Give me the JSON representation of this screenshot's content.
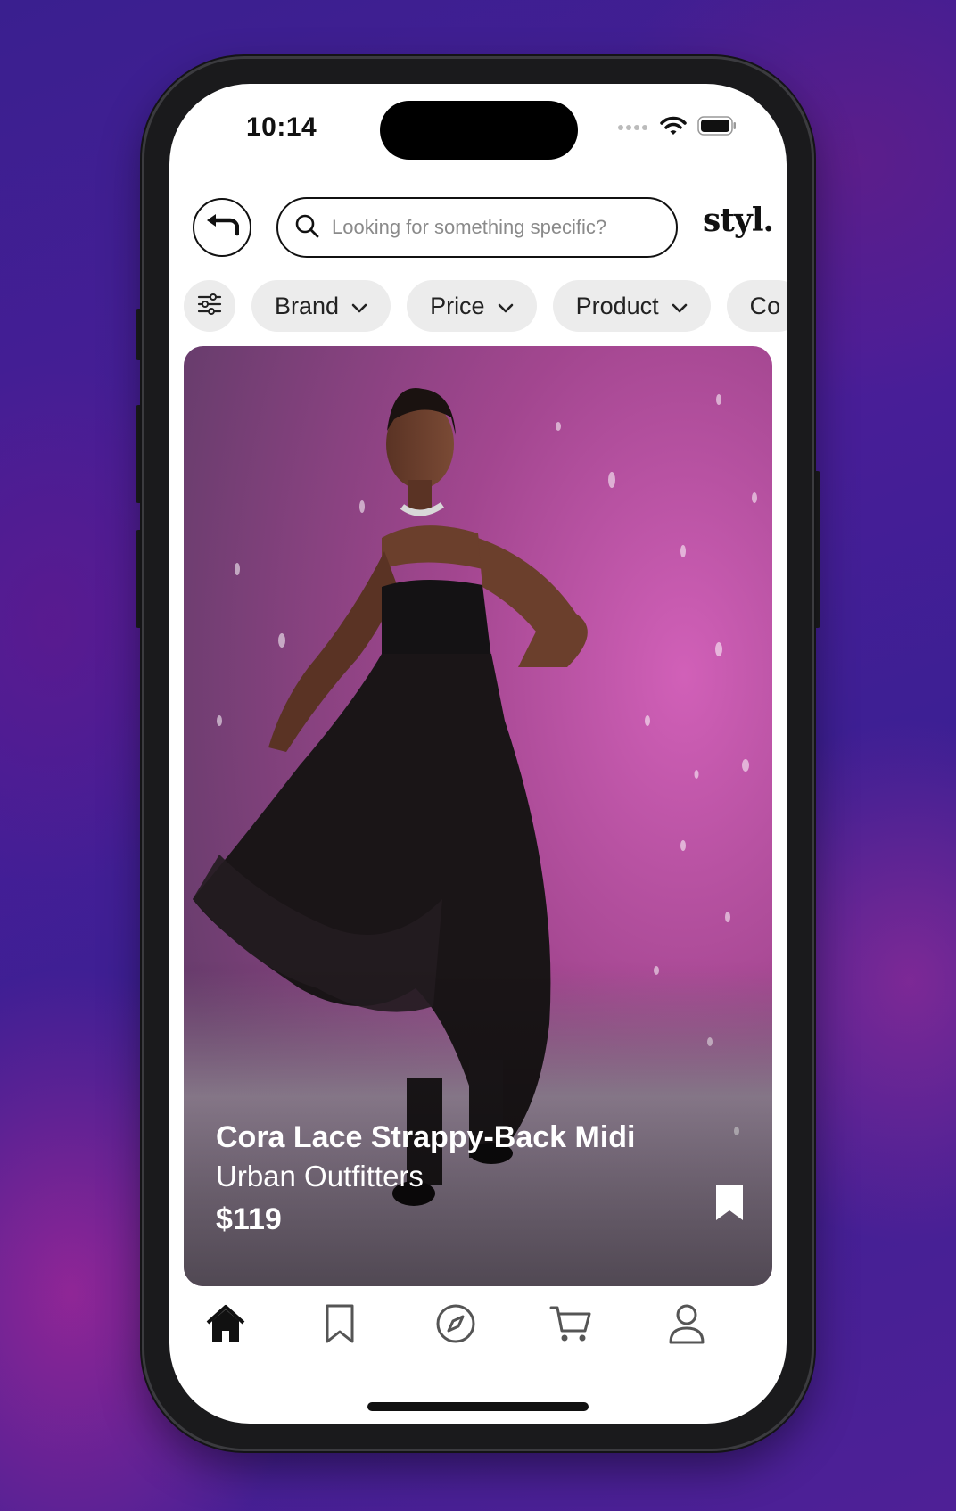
{
  "status_bar": {
    "time": "10:14"
  },
  "header": {
    "search_placeholder": "Looking for something specific?",
    "logo": "styl."
  },
  "filters": [
    {
      "label": "Brand"
    },
    {
      "label": "Price"
    },
    {
      "label": "Product"
    },
    {
      "label": "Co"
    }
  ],
  "product": {
    "name": "Cora Lace Strappy-Back Midi",
    "brand": "Urban Outfitters",
    "price": "$119"
  },
  "tab_bar": {
    "active": "home",
    "tabs": [
      "home-icon",
      "bookmark-icon",
      "compass-icon",
      "cart-icon",
      "profile-icon"
    ]
  },
  "colors": {
    "background_purple": "#3b1f93",
    "chip_bg": "#ececec",
    "text": "#111111",
    "photo_pink": "#b64a9a"
  }
}
